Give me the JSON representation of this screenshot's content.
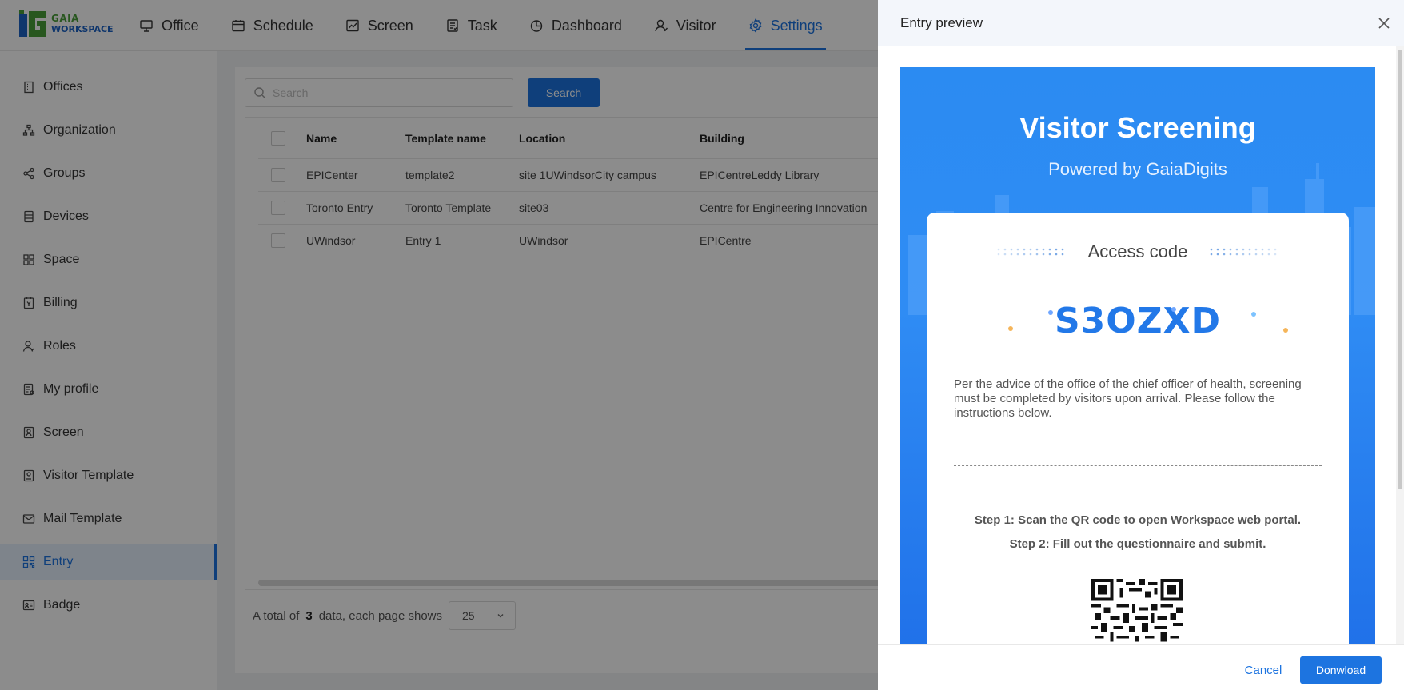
{
  "header": {
    "logo": {
      "line1": "GAIA",
      "line2": "WORKSPACE"
    },
    "nav": [
      {
        "label": "Office",
        "icon": "monitor-icon"
      },
      {
        "label": "Schedule",
        "icon": "calendar-icon"
      },
      {
        "label": "Screen",
        "icon": "chart-line-icon"
      },
      {
        "label": "Task",
        "icon": "task-icon"
      },
      {
        "label": "Dashboard",
        "icon": "pie-chart-icon"
      },
      {
        "label": "Visitor",
        "icon": "visitor-icon"
      },
      {
        "label": "Settings",
        "icon": "gear-icon",
        "active": true
      }
    ]
  },
  "sidebar": {
    "items": [
      {
        "label": "Offices",
        "icon": "building-icon"
      },
      {
        "label": "Organization",
        "icon": "org-chart-icon"
      },
      {
        "label": "Groups",
        "icon": "share-icon"
      },
      {
        "label": "Devices",
        "icon": "device-icon"
      },
      {
        "label": "Space",
        "icon": "space-icon"
      },
      {
        "label": "Billing",
        "icon": "billing-icon"
      },
      {
        "label": "Roles",
        "icon": "roles-icon"
      },
      {
        "label": "My profile",
        "icon": "profile-icon"
      },
      {
        "label": "Screen",
        "icon": "screen-icon"
      },
      {
        "label": "Visitor Template",
        "icon": "visitor-template-icon"
      },
      {
        "label": "Mail Template",
        "icon": "mail-icon"
      },
      {
        "label": "Entry",
        "icon": "qr-icon",
        "active": true
      },
      {
        "label": "Badge",
        "icon": "badge-icon"
      }
    ]
  },
  "main": {
    "search": {
      "placeholder": "Search",
      "value": "",
      "button": "Search"
    },
    "table": {
      "columns": [
        "Name",
        "Template name",
        "Location",
        "Building"
      ],
      "rows": [
        [
          "EPICenter",
          "template2",
          "site 1UWindsorCity campus",
          "EPICentreLeddy Library"
        ],
        [
          "Toronto Entry",
          "Toronto Template",
          "site03",
          "Centre for Engineering Innovation"
        ],
        [
          "UWindsor",
          "Entry 1",
          "UWindsor",
          "EPICentre"
        ]
      ]
    },
    "pager": {
      "prefix": "A total of",
      "total": "3",
      "suffix": "data, each page shows",
      "page_size": "25"
    }
  },
  "drawer": {
    "title": "Entry preview",
    "poster": {
      "title": "Visitor Screening",
      "subtitle": "Powered by GaiaDigits",
      "access_label": "Access code",
      "code": "S3OZXD",
      "description": "Per the advice of the office of the chief officer of health, screening must be completed by visitors upon arrival. Please follow the instructions below.",
      "step1": "Step 1: Scan the QR code to open Workspace web portal.",
      "step2": "Step 2: Fill out the questionnaire and submit."
    },
    "cancel": "Cancel",
    "download": "Donwload"
  },
  "colors": {
    "accent": "#1d74e0",
    "poster_bg": "#2b8bf2",
    "code": "#2278e8"
  }
}
